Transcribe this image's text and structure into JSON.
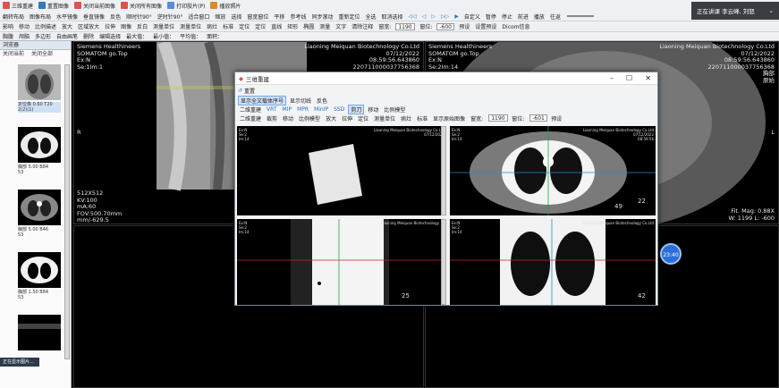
{
  "toolbar1": {
    "items": [
      {
        "label": "三维重建",
        "icon": "cube-icon",
        "color": "#d9534f"
      },
      {
        "label": "重置图像",
        "icon": "reset-icon",
        "color": "#337ab7"
      },
      {
        "label": "关闭当前图像",
        "icon": "close-image-icon",
        "color": "#d9534f"
      },
      {
        "label": "关闭所有图像",
        "icon": "close-all-icon",
        "color": "#d9534f"
      },
      {
        "label": "打印胶片(P)",
        "icon": "print-icon",
        "color": "#5a8dd6"
      },
      {
        "label": "播放照片",
        "icon": "play-photo-icon",
        "color": "#d98c2a"
      }
    ]
  },
  "toolbar1b": {
    "items": [
      "翻转布局",
      "图像布局",
      "水平镜像",
      "垂直镜像",
      "反色",
      "顺时针90°",
      "逆时针90°",
      "适合窗口",
      "缩放",
      "选择",
      "窗宽窗位",
      "平移",
      "参考线",
      "同步滚动",
      "重新定位",
      "全选",
      "取消选择"
    ],
    "nav": [
      "◁◁",
      "◁",
      "▷",
      "▷▷",
      "▶"
    ],
    "right": [
      "自定义",
      "暂停",
      "停止",
      "前进",
      "播放",
      "往返"
    ]
  },
  "toolbar2": {
    "items": [
      "影响",
      "移动",
      "比例描述",
      "放大",
      "区域放大",
      "拉伸",
      "图像",
      "反白",
      "测量单位",
      "测量单位",
      "病灶",
      "标准",
      "定位",
      "定位",
      "直线",
      "矩形",
      "椭圆",
      "测量",
      "文字",
      "清除注释",
      "窗宽:"
    ],
    "window_width": "1190",
    "window_level_label": "窗位:",
    "window_level": "-600",
    "preset_label": "预设",
    "settings": "设置预设",
    "dicom": "Dicom信息"
  },
  "toolbar3": {
    "items": [
      "胸腹",
      "颅脑",
      "多边形",
      "自由画笔",
      "删除",
      "编辑选择",
      "最大值：",
      "最小值：",
      "平均值：",
      "面积："
    ]
  },
  "left": {
    "title": "浏览器",
    "tabs": [
      "关闭当前",
      "关闭全部"
    ],
    "thumbs": [
      {
        "caption": "定位像 0.60 T20\n2(2)(1)"
      },
      {
        "caption": "胸部 5.00 B84\n53"
      },
      {
        "caption": "胸部 5.00 B46\n53"
      },
      {
        "caption": "胸部 1.50 B84\n53"
      },
      {
        "caption": ""
      }
    ]
  },
  "viewport1": {
    "tl": "Siemens Healthineers\nSOMATOM go.Top\nEx:N\nSe:1Im:1",
    "tr": "Liaoning Meiquan Biotechnology Co.Ltd\n07/12/2022\n08:59:56.643860\n220711000037756368",
    "bl": "512X512\nKV:100\nmA:60\nFOV:500.70mm\nmm/-629.5",
    "orient_l": "R",
    "orient_r": "L"
  },
  "viewport2": {
    "tl": "Siemens Healthineers\nSOMATOM go.Top\nEx:N\nSe:2Im:14",
    "tr": "Liaoning Meiquan Biotechnology Co.Ltd\n07/12/2022\n08:59:56.643860\n220711000037756368\n胸部\n原始",
    "br": "Fit. Mag: 0.88X\nW: 1199 L: -600",
    "orient_r": "L"
  },
  "dialog": {
    "title": "三维重建",
    "toolbar_reset": "重置",
    "tabs": [
      "显示全文载体序号",
      "显示切线",
      "反色"
    ],
    "modes": [
      "二维重建",
      "VRT",
      "MIP",
      "MPR",
      "MinIP",
      "SSD",
      "剪刀",
      "移动",
      "比例模型"
    ],
    "tools": [
      "二维重建",
      "裁剪",
      "移动",
      "比例模型",
      "放大",
      "拉伸",
      "定位",
      "测量单位",
      "病灶",
      "标准",
      "显示原始图像",
      "窗宽:"
    ],
    "ww": "1190",
    "wl_label": "窗位:",
    "wl": "-601",
    "preset": "预设",
    "views": [
      {
        "tl": "Ex:N\nSe:2\nIm:14",
        "tr": "Liaoning Meiquan Biotechnology Co.Ltd\n07/12/2022",
        "num": ""
      },
      {
        "tl": "Ex:N\nSe:2\nIm:14",
        "tr": "Liaoning Meiquan Biotechnology Co.Ltd\n07/12/2022\n08:59:56",
        "num": "22",
        "num2": "49"
      },
      {
        "tl": "Ex:N\nSe:2\nIm:14",
        "tr": "Liaoning Meiquan Biotechnology",
        "num": "25"
      },
      {
        "tl": "Ex:N\nSe:2\nIm:14",
        "tr": "Liaoning Meiquan Biotechnology Co.Ltd",
        "num": "42"
      }
    ]
  },
  "screen_share": "正在讲课  李云峰, 刘怒",
  "time_badge": "23:40",
  "toast": "正在显示图片..."
}
